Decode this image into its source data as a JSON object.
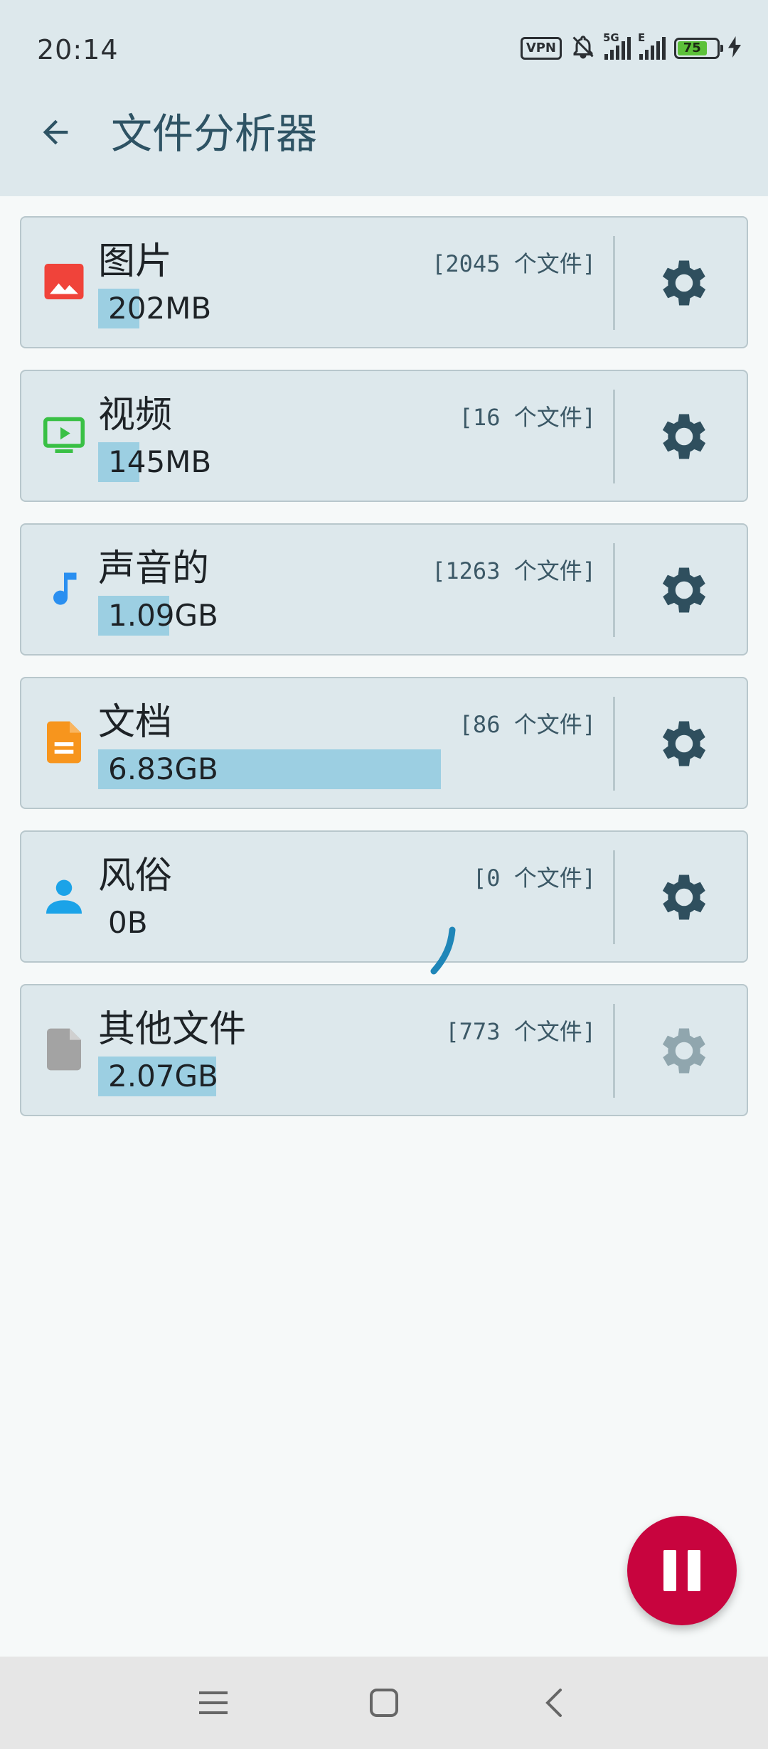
{
  "status_bar": {
    "time": "20:14",
    "vpn_label": "VPN",
    "network_5g": "5G",
    "network_e": "E",
    "battery": "75"
  },
  "header": {
    "title": "文件分析器"
  },
  "categories": [
    {
      "name": "图片",
      "count": "[2045 个文件]",
      "size": "202MB",
      "usage_fraction": 0.06,
      "icon": "image-icon",
      "color": "#f0433a"
    },
    {
      "name": "视频",
      "count": "[16 个文件]",
      "size": "145MB",
      "usage_fraction": 0.06,
      "icon": "video-icon",
      "color": "#39c045"
    },
    {
      "name": "声音的",
      "count": "[1263 个文件]",
      "size": "1.09GB",
      "usage_fraction": 0.1,
      "icon": "music-note-icon",
      "color": "#2a8ff0"
    },
    {
      "name": "文档",
      "count": "[86 个文件]",
      "size": "6.83GB",
      "usage_fraction": 0.65,
      "icon": "document-icon",
      "color": "#f7951d"
    },
    {
      "name": "风俗",
      "count": "[0 个文件]",
      "size": "0B",
      "usage_fraction": 0.0,
      "icon": "person-icon",
      "color": "#1ba3e8"
    },
    {
      "name": "其他文件",
      "count": "[773 个文件]",
      "size": "2.07GB",
      "usage_fraction": 0.22,
      "icon": "file-icon",
      "color": "#a3a3a3"
    }
  ],
  "colors": {
    "gear_active": "#2f4f5e",
    "gear_disabled": "#90a6ae",
    "usage_bar": "#9ccfe2",
    "fab": "#c8043e"
  }
}
